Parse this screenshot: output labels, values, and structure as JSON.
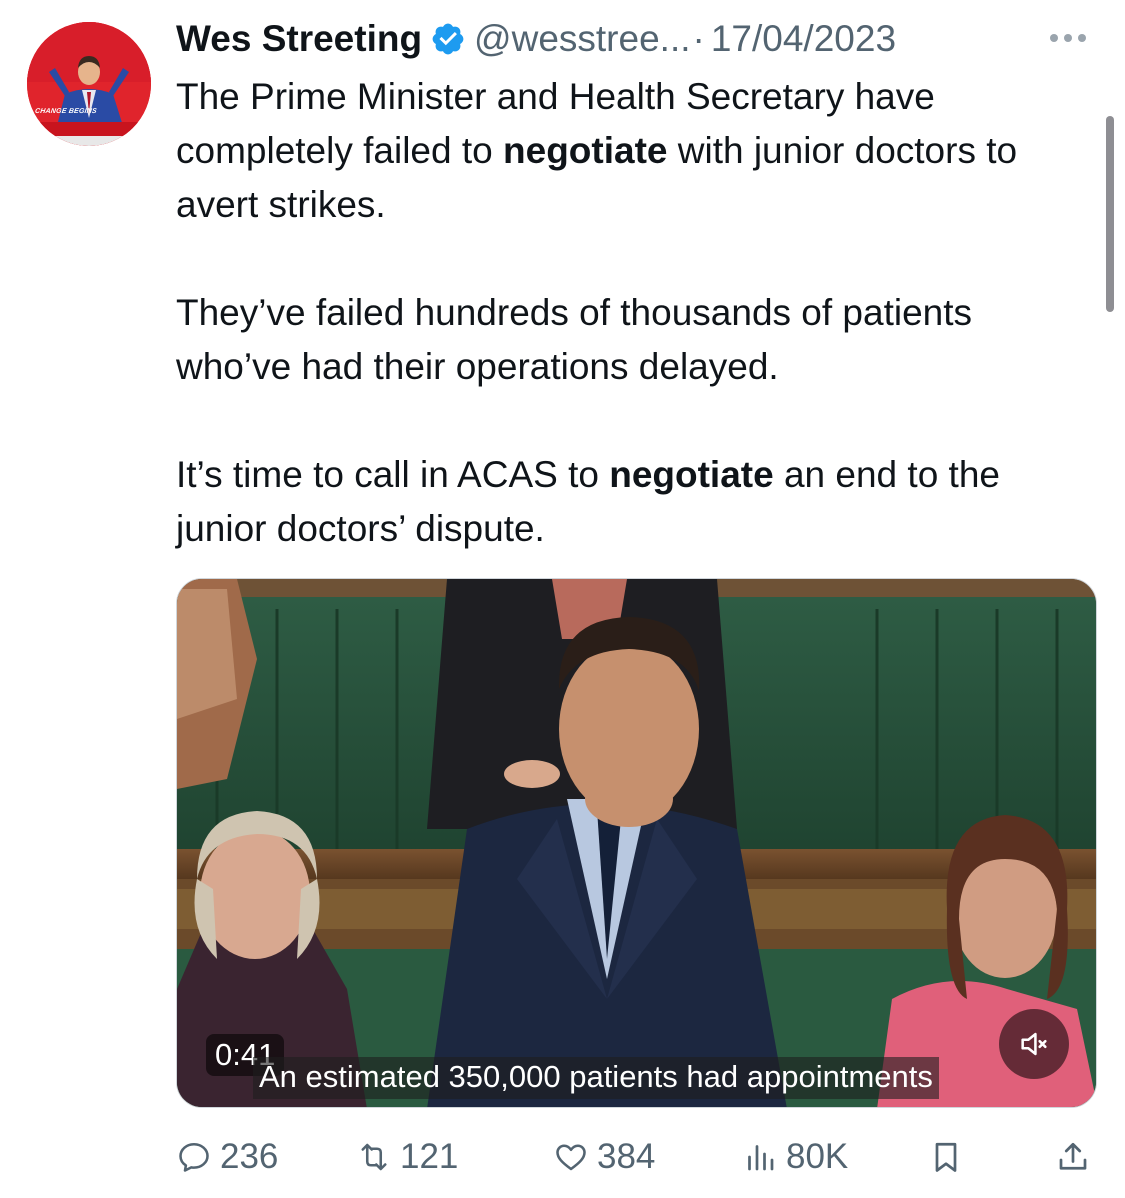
{
  "author": {
    "name": "Wes Streeting",
    "handle": "@wesstree...",
    "date": "17/04/2023",
    "avatar_slogan": "CHANGE BEGINS"
  },
  "tweet": {
    "p1_a": "The Prime Minister and Health Secretary have completely failed to ",
    "p1_bold": "negotiate",
    "p1_b": " with junior doctors to avert strikes.",
    "p2": "They’ve failed hundreds of thousands of patients who’ve had their operations delayed.",
    "p3_a": "It’s time to call in ACAS to ",
    "p3_bold": "negotiate",
    "p3_b": " an end to the junior doctors’ dispute."
  },
  "video": {
    "duration": "0:41",
    "caption": "An estimated 350,000 patients had appointments",
    "muted": true
  },
  "actions": {
    "replies": "236",
    "reposts": "121",
    "likes": "384",
    "views": "80K"
  },
  "icons": {
    "verified": "verified-badge-icon",
    "more": "more-icon",
    "mute": "mute-icon",
    "reply": "reply-icon",
    "repost": "repost-icon",
    "like": "heart-icon",
    "views": "views-icon",
    "bookmark": "bookmark-icon",
    "share": "share-icon"
  },
  "colors": {
    "verified_blue": "#1d9bf0",
    "secondary_text": "#536471",
    "avatar_red": "#e0242c"
  }
}
